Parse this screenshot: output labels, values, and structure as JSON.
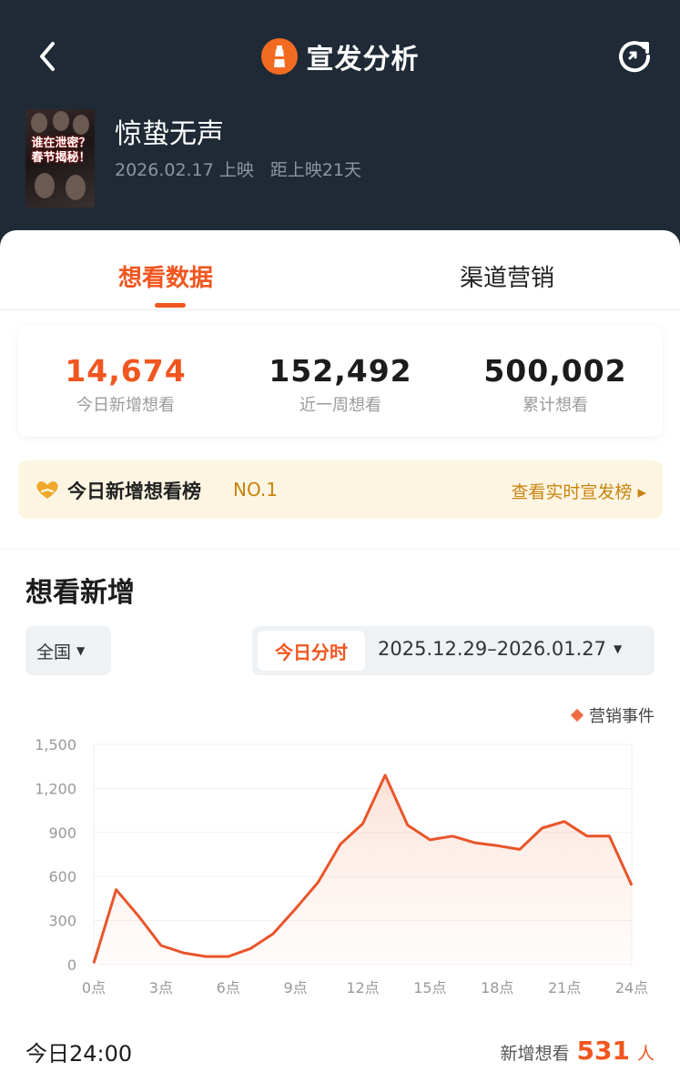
{
  "header": {
    "title": "宣发分析",
    "back_icon": "back-arrow-icon",
    "refresh_icon": "refresh-icon",
    "logo_icon": "lighthouse-icon"
  },
  "movie": {
    "title": "惊蛰无声",
    "release": "2026.02.17 上映",
    "countdown": "距上映21天",
    "poster_text": "谁在泄密？春节揭秘！"
  },
  "tabs": [
    {
      "label": "想看数据",
      "active": true
    },
    {
      "label": "渠道营销",
      "active": false
    }
  ],
  "stats": [
    {
      "value": "14,674",
      "label": "今日新增想看"
    },
    {
      "value": "152,492",
      "label": "近一周想看"
    },
    {
      "value": "500,002",
      "label": "累计想看"
    }
  ],
  "rank": {
    "label": "今日新增想看榜",
    "value": "NO.1",
    "link": "查看实时宣发榜 ▸"
  },
  "section": {
    "title": "想看新增",
    "region": "全国",
    "today_button": "今日分时",
    "date_range": "2025.12.29–2026.01.27",
    "legend": "营销事件"
  },
  "chart_data": {
    "type": "area",
    "x": [
      0,
      1,
      2,
      3,
      4,
      5,
      6,
      7,
      8,
      9,
      10,
      11,
      12,
      13,
      14,
      15,
      16,
      17,
      18,
      19,
      20,
      21,
      22,
      23,
      24
    ],
    "values": [
      10,
      510,
      330,
      130,
      80,
      55,
      55,
      110,
      210,
      380,
      560,
      820,
      960,
      1290,
      950,
      850,
      875,
      830,
      810,
      785,
      930,
      975,
      875,
      875,
      540
    ],
    "ylim": [
      0,
      1500
    ],
    "y_ticks": [
      "1,500",
      "1,200",
      "900",
      "600",
      "300",
      "0"
    ],
    "x_ticks": [
      "0点",
      "3点",
      "6点",
      "9点",
      "12点",
      "15点",
      "18点",
      "21点",
      "24点"
    ],
    "grid": true,
    "color": "#e8552a"
  },
  "footer": {
    "time_label": "今日24:00",
    "new_label": "新增想看",
    "new_value": "531",
    "new_unit": "人"
  }
}
